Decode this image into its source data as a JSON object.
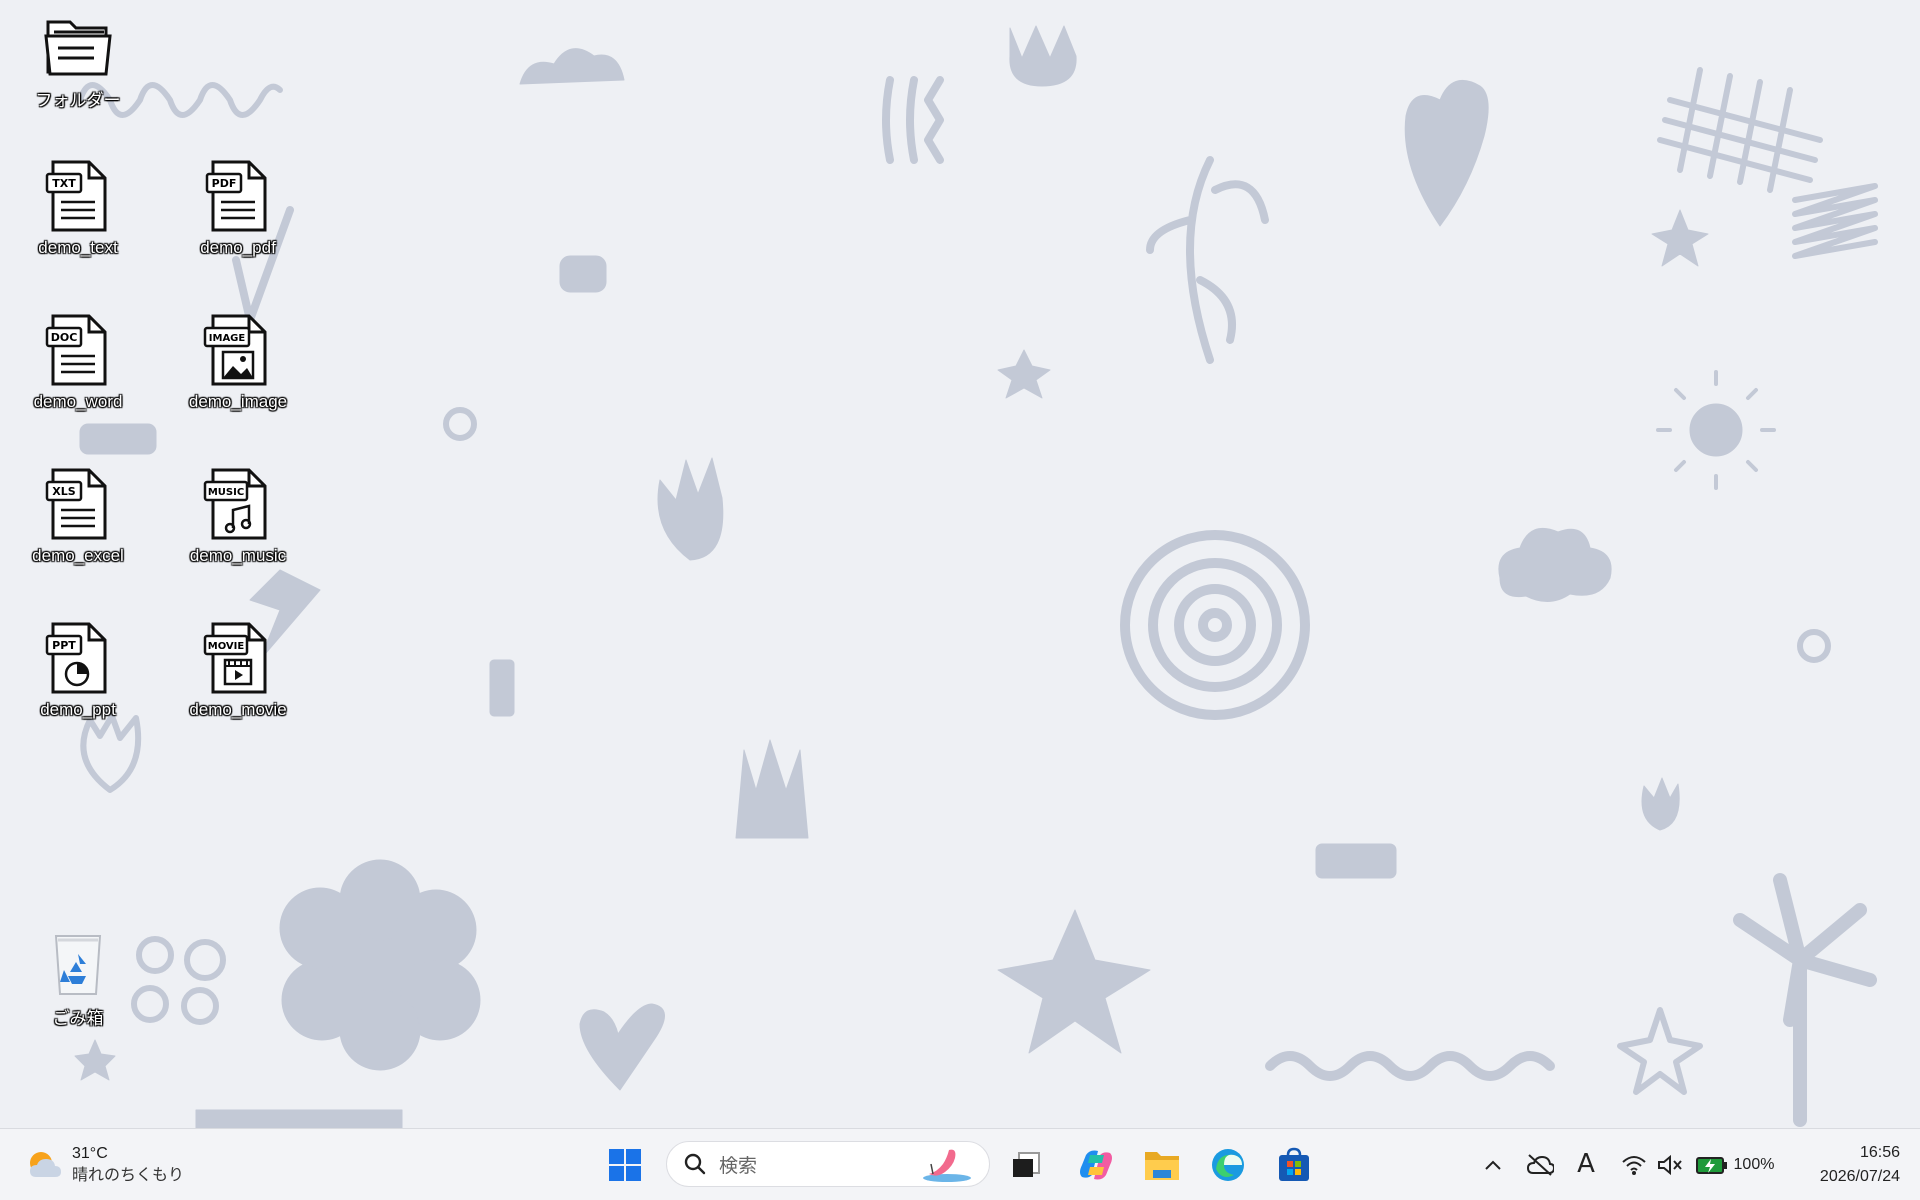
{
  "desktop": {
    "icons": [
      {
        "label": "フォルダー",
        "icon": "folder-icon"
      },
      {
        "label": "demo_text",
        "icon": "txt-file-icon",
        "badge": "TXT"
      },
      {
        "label": "demo_pdf",
        "icon": "pdf-file-icon",
        "badge": "PDF"
      },
      {
        "label": "demo_word",
        "icon": "doc-file-icon",
        "badge": "DOC"
      },
      {
        "label": "demo_image",
        "icon": "image-file-icon",
        "badge": "IMAGE"
      },
      {
        "label": "demo_excel",
        "icon": "xls-file-icon",
        "badge": "XLS"
      },
      {
        "label": "demo_music",
        "icon": "music-file-icon",
        "badge": "MUSIC"
      },
      {
        "label": "demo_ppt",
        "icon": "ppt-file-icon",
        "badge": "PPT"
      },
      {
        "label": "demo_movie",
        "icon": "movie-file-icon",
        "badge": "MOVIE"
      },
      {
        "label": "ごみ箱",
        "icon": "recycle-bin-icon"
      }
    ]
  },
  "taskbar": {
    "weather": {
      "temp": "31°C",
      "condition": "晴れのちくもり",
      "icon": "partly-sunny-icon"
    },
    "search": {
      "placeholder": "検索",
      "icon": "search-icon"
    },
    "pinned": [
      {
        "name": "start-button",
        "icon": "windows-logo-icon"
      },
      {
        "name": "task-view",
        "icon": "task-view-icon"
      },
      {
        "name": "copilot",
        "icon": "copilot-icon"
      },
      {
        "name": "file-explorer",
        "icon": "folder-icon"
      },
      {
        "name": "edge",
        "icon": "edge-icon"
      },
      {
        "name": "store",
        "icon": "store-icon"
      }
    ],
    "tray": {
      "ime": "A",
      "battery": "100%",
      "time": "16:56",
      "date": "2026/07/24"
    },
    "colors": {
      "accent": "#1a73e8",
      "doodle": "#c3c9d6"
    }
  }
}
